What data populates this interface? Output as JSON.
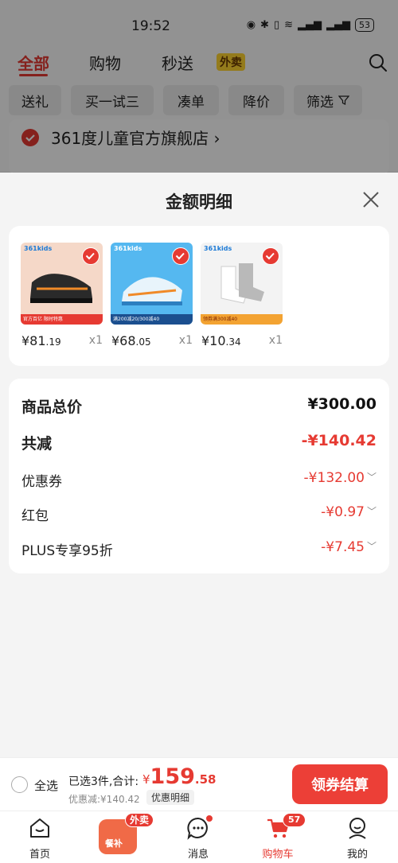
{
  "status": {
    "time": "19:52",
    "battery": "53"
  },
  "tabs": [
    {
      "label": "全部"
    },
    {
      "label": "购物"
    },
    {
      "label": "秒送"
    }
  ],
  "waimai_badge": "外卖",
  "chips": [
    {
      "label": "送礼"
    },
    {
      "label": "买一试三"
    },
    {
      "label": "凑单"
    },
    {
      "label": "降价"
    },
    {
      "label": "筛选"
    }
  ],
  "store_name": "361度儿童官方旗舰店",
  "sheet": {
    "title": "金额明细"
  },
  "products": [
    {
      "price_int": "¥81",
      "price_dec": ".19",
      "qty": "x1",
      "brand": "361kids",
      "bar": "官方百亿 限时特惠",
      "color": "#f5d8c8"
    },
    {
      "price_int": "¥68",
      "price_dec": ".05",
      "qty": "x1",
      "brand": "361kids",
      "bar": "满200减20/300减40",
      "color": "#55b8f0"
    },
    {
      "price_int": "¥10",
      "price_dec": ".34",
      "qty": "x1",
      "brand": "361kids",
      "bar": "领券满300减40",
      "color": "#f3f3f3"
    }
  ],
  "summary": {
    "total_label": "商品总价",
    "total_value": "¥300.00",
    "discount_label": "共减",
    "discount_value": "-¥140.42",
    "coupon_label": "优惠券",
    "coupon_value": "-¥132.00",
    "redpack_label": "红包",
    "redpack_value": "-¥0.97",
    "plus_label": "PLUS专享95折",
    "plus_value": "-¥7.45"
  },
  "bottom": {
    "select_all": "全选",
    "selected_info": "已选3件,合计:",
    "currency": "¥",
    "total_int": "159",
    "total_dec": ".58",
    "saved": "优惠减:¥140.42",
    "detail_btn": "优惠明细",
    "checkout": "领券结算"
  },
  "nav": [
    {
      "label": "首页"
    },
    {
      "label": "消息"
    },
    {
      "label": "购物车",
      "badge": "57"
    },
    {
      "label": "我的"
    }
  ],
  "center": {
    "badge": "外卖",
    "label": "餐补"
  },
  "colors": {
    "accent": "#e63a32"
  }
}
